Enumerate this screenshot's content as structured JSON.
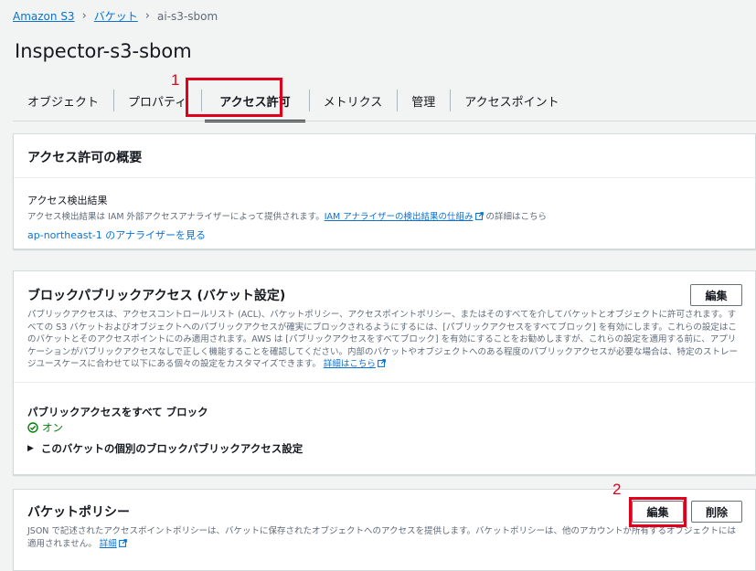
{
  "breadcrumb": {
    "items": [
      "Amazon S3",
      "バケット"
    ],
    "current": "ai-s3-sbom"
  },
  "page": {
    "title": "Inspector-s3-sbom"
  },
  "tabs": [
    {
      "label": "オブジェクト"
    },
    {
      "label": "プロパティ"
    },
    {
      "label": "アクセス許可",
      "active": true
    },
    {
      "label": "メトリクス"
    },
    {
      "label": "管理"
    },
    {
      "label": "アクセスポイント"
    }
  ],
  "annotations": {
    "first": "1",
    "second": "2",
    "color": "#e0001b"
  },
  "access_overview": {
    "title": "アクセス許可の概要",
    "findings_label": "アクセス検出結果",
    "findings_desc_pre": "アクセス検出結果は IAM 外部アクセスアナライザーによって提供されます。",
    "findings_link": "IAM アナライザーの検出結果の仕組み",
    "findings_desc_post": " の詳細はこちら",
    "analyzer_link": "ap-northeast-1 のアナライザーを見る"
  },
  "block_public": {
    "title": "ブロックパブリックアクセス (バケット設定)",
    "edit_label": "編集",
    "desc": "パブリックアクセスは、アクセスコントロールリスト (ACL)、バケットポリシー、アクセスポイントポリシー、またはそのすべてを介してバケットとオブジェクトに許可されます。すべての S3 バケットおよびオブジェクトへのパブリックアクセスが確実にブロックされるようにするには、[パブリックアクセスをすべてブロック] を有効にします。これらの設定はこのバケットとそのアクセスポイントにのみ適用されます。AWS は [パブリックアクセスをすべてブロック] を有効にすることをお勧めしますが、これらの設定を適用する前に、アプリケーションがパブリックアクセスなしで正しく機能することを確認してください。内部のバケットやオブジェクトへのある程度のパブリックアクセスが必要な場合は、特定のストレージユースケースに合わせて以下にある個々の設定をカスタマイズできます。",
    "desc_link": "詳細はこちら",
    "setting_label": "パブリックアクセスをすべて ブロック",
    "status": "オン",
    "expand_label": "このバケットの個別のブロックパブリックアクセス設定",
    "status_color": "#037f0c"
  },
  "bucket_policy": {
    "title": "バケットポリシー",
    "edit_label": "編集",
    "delete_label": "削除",
    "desc": "JSON で記述されたアクセスポイントポリシーは、バケットに保存されたオブジェクトへのアクセスを提供します。バケットポリシーは、他のアカウントが所有するオブジェクトには適用されません。",
    "desc_link": "詳細"
  },
  "colors": {
    "link": "#0972d3",
    "text": "#16191f",
    "muted": "#5f6b7a"
  }
}
